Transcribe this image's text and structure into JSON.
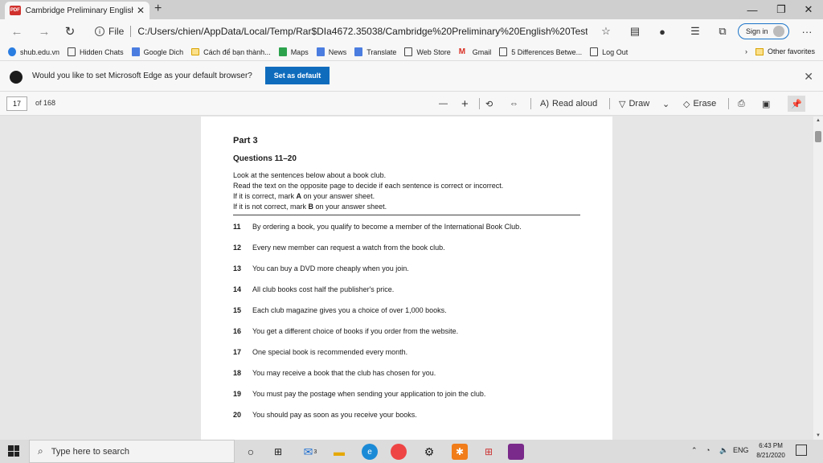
{
  "browser": {
    "tab_title": "Cambridge Preliminary English Te",
    "pdf_badge": "PDF",
    "address_label": "File",
    "url": "C:/Users/chien/AppData/Local/Temp/Rar$DIa4672.35038/Cambridge%20Preliminary%20English%20Test...",
    "sign_in": "Sign in",
    "favorites": [
      {
        "label": "shub.edu.vn",
        "icon": "shub-icon"
      },
      {
        "label": "Hidden Chats",
        "icon": "page-icon"
      },
      {
        "label": "Google Dich",
        "icon": "translate-icon"
      },
      {
        "label": "Cách để bạn thành...",
        "icon": "folder-icon"
      },
      {
        "label": "Maps",
        "icon": "maps-icon"
      },
      {
        "label": "News",
        "icon": "news-icon"
      },
      {
        "label": "Translate",
        "icon": "translate-icon"
      },
      {
        "label": "Web Store",
        "icon": "page-icon"
      },
      {
        "label": "Gmail",
        "icon": "gmail-icon"
      },
      {
        "label": "5 Differences Betwe...",
        "icon": "page-icon"
      },
      {
        "label": "Log Out",
        "icon": "page-icon"
      }
    ],
    "other_favorites": "Other favorites",
    "default_prompt": "Would you like to set Microsoft Edge as your default browser?",
    "set_default": "Set as default"
  },
  "pdf_toolbar": {
    "page_number": "17",
    "page_total": "of 168",
    "read_aloud": "Read aloud",
    "draw": "Draw",
    "erase": "Erase"
  },
  "document": {
    "part": "Part 3",
    "questions_range": "Questions 11–20",
    "instructions": [
      "Look at the sentences below about a book club.",
      "Read the text on the opposite page to decide if each sentence is correct or incorrect.",
      "If it is correct, mark A on your answer sheet.",
      "If it is not correct, mark B on your answer sheet."
    ],
    "questions": [
      {
        "num": "11",
        "text": "By ordering a book, you qualify to become a member of the International Book Club."
      },
      {
        "num": "12",
        "text": "Every new member can request a watch from the book club."
      },
      {
        "num": "13",
        "text": "You can buy a DVD more cheaply when you join."
      },
      {
        "num": "14",
        "text": "All club books cost half the publisher's price."
      },
      {
        "num": "15",
        "text": "Each club magazine gives you a choice of over 1,000 books."
      },
      {
        "num": "16",
        "text": "You get a different choice of books if you order from the website."
      },
      {
        "num": "17",
        "text": "One special book is recommended every month."
      },
      {
        "num": "18",
        "text": "You may receive a book that the club has chosen for you."
      },
      {
        "num": "19",
        "text": "You must pay the postage when sending your application to join the club."
      },
      {
        "num": "20",
        "text": "You should pay as soon as you receive your books."
      }
    ]
  },
  "taskbar": {
    "search_placeholder": "Type here to search",
    "mail_badge": "3",
    "language": "ENG",
    "time": "6:43 PM",
    "date": "8/21/2020"
  }
}
